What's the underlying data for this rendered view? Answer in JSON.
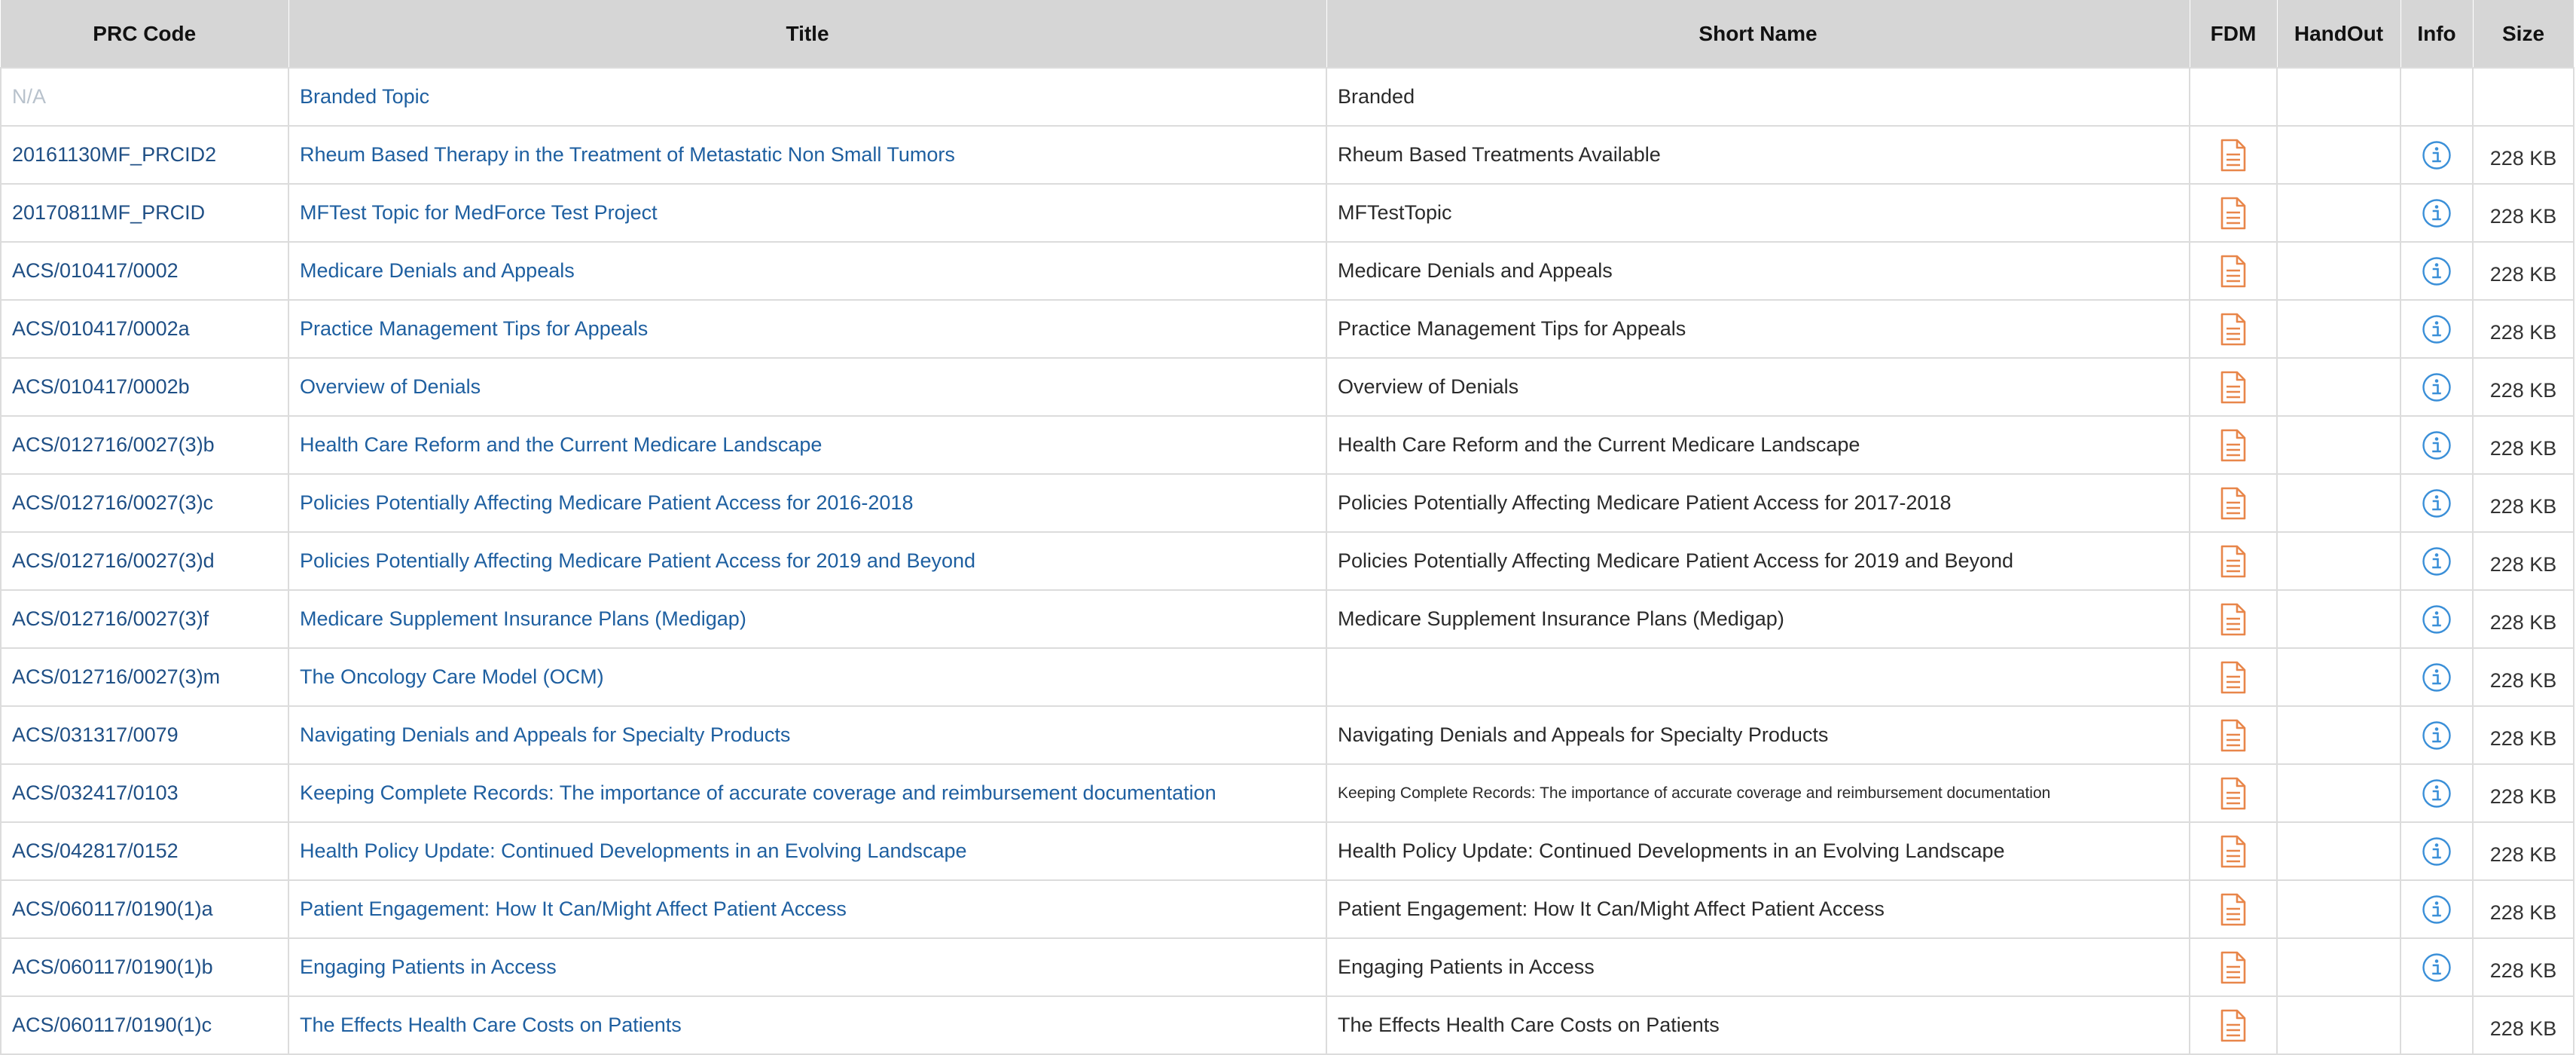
{
  "table": {
    "headers": {
      "code": "PRC Code",
      "title": "Title",
      "short": "Short Name",
      "fdm": "FDM",
      "handout": "HandOut",
      "info": "Info",
      "size": "Size"
    },
    "rows": [
      {
        "code": "N/A",
        "title": "Branded Topic",
        "short": "Branded",
        "fdm": false,
        "info": false,
        "size": ""
      },
      {
        "code": "20161130MF_PRCID2",
        "title": "Rheum Based Therapy in the Treatment of Metastatic Non Small Tumors",
        "short": "Rheum Based Treatments Available",
        "fdm": true,
        "info": true,
        "size": "228 KB"
      },
      {
        "code": "20170811MF_PRCID",
        "title": "MFTest Topic for MedForce Test Project",
        "short": "MFTestTopic",
        "fdm": true,
        "info": true,
        "size": "228 KB"
      },
      {
        "code": "ACS/010417/0002",
        "title": "Medicare Denials and Appeals",
        "short": "Medicare Denials and Appeals",
        "fdm": true,
        "info": true,
        "size": "228 KB"
      },
      {
        "code": "ACS/010417/0002a",
        "title": "Practice Management Tips for Appeals",
        "short": "Practice Management Tips for Appeals",
        "fdm": true,
        "info": true,
        "size": "228 KB"
      },
      {
        "code": "ACS/010417/0002b",
        "title": "Overview of Denials",
        "short": "Overview of Denials",
        "fdm": true,
        "info": true,
        "size": "228 KB"
      },
      {
        "code": "ACS/012716/0027(3)b",
        "title": "Health Care Reform and the Current Medicare Landscape",
        "short": "Health Care Reform and the Current Medicare Landscape",
        "fdm": true,
        "info": true,
        "size": "228 KB"
      },
      {
        "code": "ACS/012716/0027(3)c",
        "title": "Policies Potentially Affecting Medicare Patient Access for 2016-2018",
        "short": "Policies Potentially Affecting Medicare Patient Access for 2017-2018",
        "fdm": true,
        "info": true,
        "size": "228 KB"
      },
      {
        "code": "ACS/012716/0027(3)d",
        "title": "Policies Potentially Affecting Medicare Patient Access for 2019 and Beyond",
        "short": "Policies Potentially Affecting Medicare Patient Access for 2019 and Beyond",
        "fdm": true,
        "info": true,
        "size": "228 KB"
      },
      {
        "code": "ACS/012716/0027(3)f",
        "title": "Medicare Supplement Insurance Plans (Medigap)",
        "short": "Medicare Supplement Insurance Plans (Medigap)",
        "fdm": true,
        "info": true,
        "size": "228 KB"
      },
      {
        "code": "ACS/012716/0027(3)m",
        "title": "The Oncology Care Model (OCM)",
        "short": "",
        "fdm": true,
        "info": true,
        "size": "228 KB"
      },
      {
        "code": "ACS/031317/0079",
        "title": "Navigating Denials and Appeals for Specialty Products",
        "short": "Navigating Denials and Appeals for Specialty Products",
        "fdm": true,
        "info": true,
        "size": "228 KB"
      },
      {
        "code": "ACS/032417/0103",
        "title": "Keeping Complete Records: The importance of accurate coverage and reimbursement documentation",
        "short": "Keeping Complete Records: The importance of accurate coverage and reimbursement documentation",
        "short_small": true,
        "fdm": true,
        "info": true,
        "size": "228 KB"
      },
      {
        "code": "ACS/042817/0152",
        "title": "Health Policy Update: Continued Developments in an Evolving Landscape",
        "short": "Health Policy Update: Continued Developments in an Evolving Landscape",
        "fdm": true,
        "info": true,
        "size": "228 KB"
      },
      {
        "code": "ACS/060117/0190(1)a",
        "title": "Patient Engagement: How It Can/Might Affect Patient Access",
        "short": "Patient Engagement: How It Can/Might Affect Patient Access",
        "fdm": true,
        "info": true,
        "size": "228 KB"
      },
      {
        "code": "ACS/060117/0190(1)b",
        "title": "Engaging Patients in Access",
        "short": "Engaging Patients in Access",
        "fdm": true,
        "info": true,
        "size": "228 KB"
      },
      {
        "code": "ACS/060117/0190(1)c",
        "title": "The Effects Health Care Costs on Patients",
        "short": "The Effects Health Care Costs on Patients",
        "fdm": true,
        "info": false,
        "size": "228 KB"
      }
    ]
  },
  "icons": {
    "fdm": "document-icon",
    "info": "info-circle-icon"
  },
  "colors": {
    "header_bg": "#d6d6d6",
    "link": "#1e5fa0",
    "doc_icon": "#e8864a",
    "info_icon": "#3a8fd8"
  }
}
